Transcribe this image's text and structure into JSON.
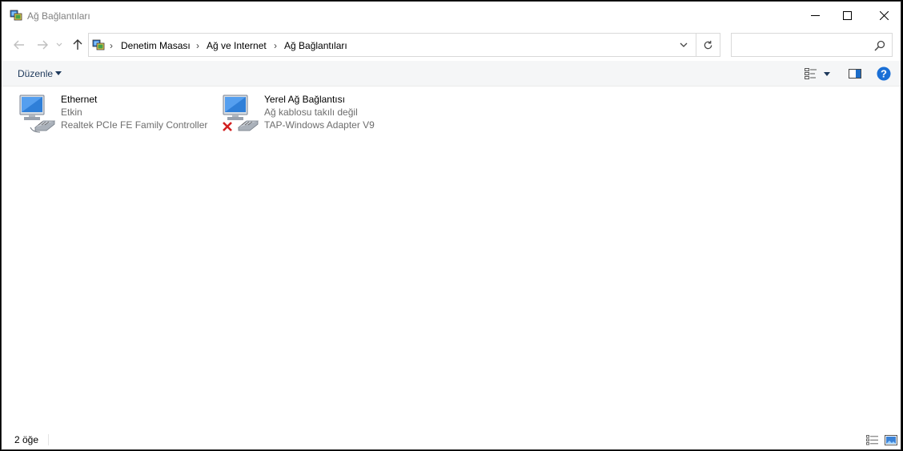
{
  "window": {
    "title": "Ağ Bağlantıları",
    "icons": {
      "app": "network-connections-icon",
      "minimize": "minimize-icon",
      "maximize": "maximize-icon",
      "close": "close-icon"
    }
  },
  "nav": {
    "icons": {
      "back": "arrow-left-icon",
      "forward": "arrow-right-icon",
      "recent": "chevron-down-icon",
      "up": "arrow-up-icon"
    }
  },
  "address": {
    "breadcrumbs": [
      "Denetim Masası",
      "Ağ ve Internet",
      "Ağ Bağlantıları"
    ],
    "separator": "›",
    "icons": {
      "location": "control-panel-icon",
      "dropdown": "chevron-down-icon",
      "refresh": "refresh-icon"
    }
  },
  "search": {
    "placeholder": "",
    "icon": "search-icon"
  },
  "commandbar": {
    "organize_label": "Düzenle",
    "icons": {
      "change_view": "view-options-icon",
      "view_menu": "caret-down-icon",
      "preview_pane": "preview-pane-icon",
      "help": "help-icon"
    }
  },
  "connections": [
    {
      "name": "Ethernet",
      "status": "Etkin",
      "device": "Realtek PCIe FE Family Controller",
      "disconnected": false,
      "icon": "network-adapter-icon"
    },
    {
      "name": "Yerel Ağ Bağlantısı",
      "status": "Ağ kablosu takılı değil",
      "device": "TAP-Windows Adapter V9",
      "disconnected": true,
      "icon": "network-adapter-disconnected-icon"
    }
  ],
  "colors": {
    "accent": "#1e6ec8",
    "help_blue": "#1a6fd6",
    "disconnect_red": "#d21f1f",
    "muted_text": "#6d6d6d"
  },
  "status": {
    "item_count": "2 öğe",
    "icons": {
      "details_view": "details-view-icon",
      "large_icons_view": "large-icons-view-icon"
    }
  }
}
